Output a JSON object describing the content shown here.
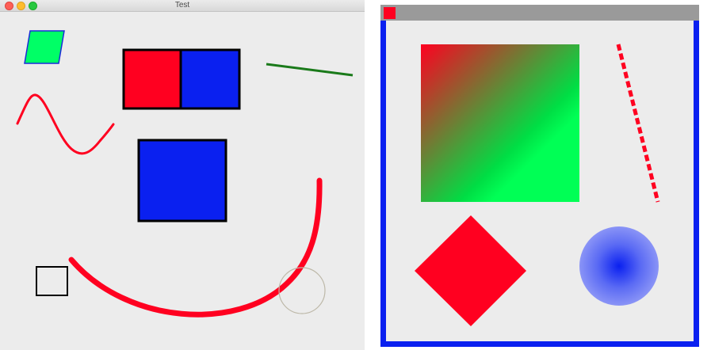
{
  "left_window": {
    "title": "Test",
    "buttons": [
      "close",
      "minimize",
      "maximize"
    ]
  },
  "right_window": {
    "icon": "app-icon"
  },
  "colors": {
    "red": "#ff0020",
    "blue": "#0a20f0",
    "green": "#00ff55",
    "dark_green": "#1a7a1a",
    "black": "#000000",
    "window_bg": "#ececec",
    "titlebar_gray": "#9a9a9a",
    "circle_outline": "#bdb8a8"
  }
}
